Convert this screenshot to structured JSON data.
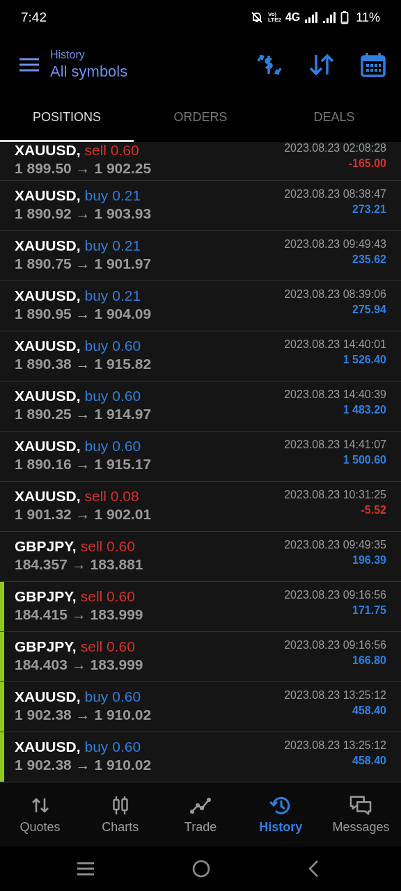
{
  "status_bar": {
    "time": "7:42",
    "volte_top": "Vo)",
    "volte_bottom": "LTE2",
    "network": "4G",
    "battery": "11%"
  },
  "header": {
    "subtitle": "History",
    "title": "All symbols"
  },
  "tabs": [
    {
      "label": "POSITIONS",
      "selected": true
    },
    {
      "label": "ORDERS",
      "selected": false
    },
    {
      "label": "DEALS",
      "selected": false
    }
  ],
  "positions": [
    {
      "symbol": "XAUUSD,",
      "trade": "sell 0.60",
      "kind": "sell",
      "prices": "1 899.50 → 1 902.25",
      "time": "2023.08.23 02:08:28",
      "profit": "-165.00",
      "loss": true,
      "marked": false
    },
    {
      "symbol": "XAUUSD,",
      "trade": "buy 0.21",
      "kind": "buy",
      "prices": "1 890.92 → 1 903.93",
      "time": "2023.08.23 08:38:47",
      "profit": "273.21",
      "loss": false,
      "marked": false
    },
    {
      "symbol": "XAUUSD,",
      "trade": "buy 0.21",
      "kind": "buy",
      "prices": "1 890.75 → 1 901.97",
      "time": "2023.08.23 09:49:43",
      "profit": "235.62",
      "loss": false,
      "marked": false
    },
    {
      "symbol": "XAUUSD,",
      "trade": "buy 0.21",
      "kind": "buy",
      "prices": "1 890.95 → 1 904.09",
      "time": "2023.08.23 08:39:06",
      "profit": "275.94",
      "loss": false,
      "marked": false
    },
    {
      "symbol": "XAUUSD,",
      "trade": "buy 0.60",
      "kind": "buy",
      "prices": "1 890.38 → 1 915.82",
      "time": "2023.08.23 14:40:01",
      "profit": "1 526.40",
      "loss": false,
      "marked": false
    },
    {
      "symbol": "XAUUSD,",
      "trade": "buy 0.60",
      "kind": "buy",
      "prices": "1 890.25 → 1 914.97",
      "time": "2023.08.23 14:40:39",
      "profit": "1 483.20",
      "loss": false,
      "marked": false
    },
    {
      "symbol": "XAUUSD,",
      "trade": "buy 0.60",
      "kind": "buy",
      "prices": "1 890.16 → 1 915.17",
      "time": "2023.08.23 14:41:07",
      "profit": "1 500.60",
      "loss": false,
      "marked": false
    },
    {
      "symbol": "XAUUSD,",
      "trade": "sell 0.08",
      "kind": "sell",
      "prices": "1 901.32 → 1 902.01",
      "time": "2023.08.23 10:31:25",
      "profit": "-5.52",
      "loss": true,
      "marked": false
    },
    {
      "symbol": "GBPJPY,",
      "trade": "sell 0.60",
      "kind": "sell",
      "prices": "184.357 → 183.881",
      "time": "2023.08.23 09:49:35",
      "profit": "196.39",
      "loss": false,
      "marked": false
    },
    {
      "symbol": "GBPJPY,",
      "trade": "sell 0.60",
      "kind": "sell",
      "prices": "184.415 → 183.999",
      "time": "2023.08.23 09:16:56",
      "profit": "171.75",
      "loss": false,
      "marked": true
    },
    {
      "symbol": "GBPJPY,",
      "trade": "sell 0.60",
      "kind": "sell",
      "prices": "184.403 → 183.999",
      "time": "2023.08.23 09:16:56",
      "profit": "166.80",
      "loss": false,
      "marked": true
    },
    {
      "symbol": "XAUUSD,",
      "trade": "buy 0.60",
      "kind": "buy",
      "prices": "1 902.38 → 1 910.02",
      "time": "2023.08.23 13:25:12",
      "profit": "458.40",
      "loss": false,
      "marked": true
    },
    {
      "symbol": "XAUUSD,",
      "trade": "buy 0.60",
      "kind": "buy",
      "prices": "1 902.38 → 1 910.02",
      "time": "2023.08.23 13:25:12",
      "profit": "458.40",
      "loss": false,
      "marked": true
    }
  ],
  "bottom_nav": [
    {
      "label": "Quotes",
      "kind": "quotes",
      "selected": false
    },
    {
      "label": "Charts",
      "kind": "charts",
      "selected": false
    },
    {
      "label": "Trade",
      "kind": "trade",
      "selected": false
    },
    {
      "label": "History",
      "kind": "history",
      "selected": true
    },
    {
      "label": "Messages",
      "kind": "messages",
      "selected": false
    }
  ]
}
